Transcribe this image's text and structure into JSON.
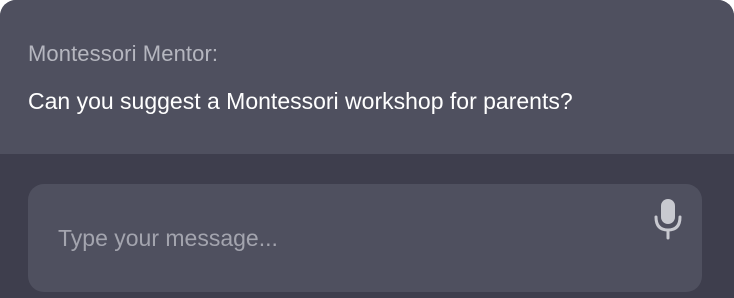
{
  "chat": {
    "sender": "Montessori Mentor:",
    "message": "Can you suggest a Montessori workshop for parents?"
  },
  "composer": {
    "placeholder": "Type your message...",
    "value": "",
    "mic_icon": "microphone-icon"
  },
  "colors": {
    "message_background": "#4f505f",
    "panel_background": "#3e3e4d",
    "input_background": "#4f505f",
    "sender_text": "#b5b6bf",
    "message_text": "#ffffff",
    "placeholder_text": "#a3a4ae",
    "icon": "#c8c9d0"
  }
}
